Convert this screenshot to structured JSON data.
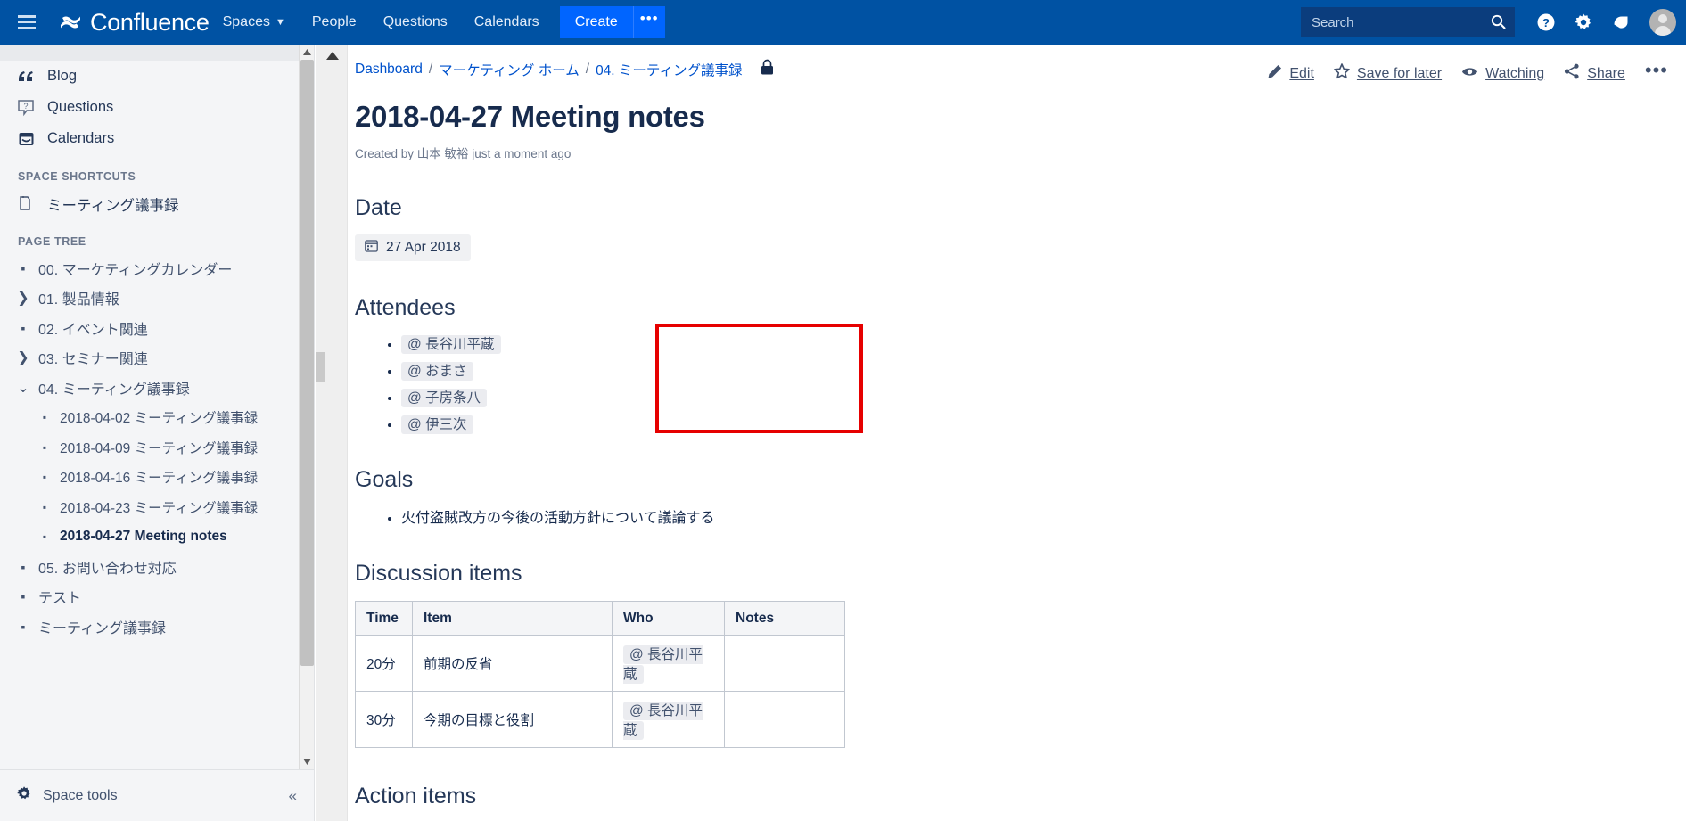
{
  "topnav": {
    "menu_icon": "hamburger-icon",
    "brand": "Confluence",
    "items": [
      {
        "label": "Spaces",
        "has_chevron": true
      },
      {
        "label": "People",
        "has_chevron": false
      },
      {
        "label": "Questions",
        "has_chevron": false
      },
      {
        "label": "Calendars",
        "has_chevron": false
      }
    ],
    "create_label": "Create",
    "create_more_label": "•••",
    "search_placeholder": "Search",
    "search_value": "",
    "icons": [
      "help-icon",
      "gear-icon",
      "notifications-icon",
      "avatar"
    ],
    "bg_color": "#0052a3",
    "create_color": "#0065ff"
  },
  "sidebar": {
    "links": [
      {
        "label": "Blog",
        "icon": "blog-quote-icon"
      },
      {
        "label": "Questions",
        "icon": "question-mark-icon"
      },
      {
        "label": "Calendars",
        "icon": "calendar-icon"
      }
    ],
    "shortcuts_heading": "SPACE SHORTCUTS",
    "shortcuts": [
      {
        "label": "ミーティング議事録",
        "icon": "pages-icon"
      }
    ],
    "pagetree_heading": "PAGE TREE",
    "tree": [
      {
        "label": "00. マーケティングカレンダー",
        "level": 0,
        "marker": "dot",
        "active": false
      },
      {
        "label": "01. 製品情報",
        "level": 0,
        "marker": "chevron-right",
        "active": false
      },
      {
        "label": "02. イベント関連",
        "level": 0,
        "marker": "dot",
        "active": false
      },
      {
        "label": "03. セミナー関連",
        "level": 0,
        "marker": "chevron-right",
        "active": false
      },
      {
        "label": "04. ミーティング議事録",
        "level": 0,
        "marker": "chevron-down",
        "active": false
      },
      {
        "label": "2018-04-02 ミーティング議事録",
        "level": 1,
        "marker": "dot",
        "active": false
      },
      {
        "label": "2018-04-09 ミーティング議事録",
        "level": 1,
        "marker": "dot",
        "active": false
      },
      {
        "label": "2018-04-16 ミーティング議事録",
        "level": 1,
        "marker": "dot",
        "active": false
      },
      {
        "label": "2018-04-23 ミーティング議事録",
        "level": 1,
        "marker": "dot",
        "active": false
      },
      {
        "label": "2018-04-27 Meeting notes",
        "level": 1,
        "marker": "dot",
        "active": true
      },
      {
        "label": "05. お問い合わせ対応",
        "level": 0,
        "marker": "dot",
        "active": false
      },
      {
        "label": "テスト",
        "level": 0,
        "marker": "dot",
        "active": false
      },
      {
        "label": "ミーティング議事録",
        "level": 0,
        "marker": "dot",
        "active": false
      }
    ],
    "space_tools_label": "Space tools",
    "collapse_label": "«"
  },
  "page": {
    "breadcrumb": [
      {
        "label": "Dashboard"
      },
      {
        "label": "マーケティング ホーム"
      },
      {
        "label": "04. ミーティング議事録"
      }
    ],
    "breadcrumb_separator": "/",
    "restriction_icon": "lock-icon",
    "actions": [
      {
        "label": "Edit",
        "icon": "pencil-icon"
      },
      {
        "label": "Save for later",
        "icon": "star-icon"
      },
      {
        "label": "Watching",
        "icon": "eye-icon"
      },
      {
        "label": "Share",
        "icon": "share-icon"
      }
    ],
    "more_actions_label": "•••",
    "title": "2018-04-27 Meeting notes",
    "byline": "Created by 山本 敏裕 just a moment ago",
    "sections": {
      "date_heading": "Date",
      "date_value": "27 Apr 2018",
      "date_icon": "calendar-icon",
      "attendees_heading": "Attendees",
      "attendees": [
        "@ 長谷川平蔵",
        "@ おまさ",
        "@ 子房条八",
        "@ 伊三次"
      ],
      "goals_heading": "Goals",
      "goals": [
        "火付盗賊改方の今後の活動方針について議論する"
      ],
      "discussion_heading": "Discussion items",
      "action_items_heading": "Action items"
    },
    "table": {
      "columns": [
        "Time",
        "Item",
        "Who",
        "Notes"
      ],
      "rows": [
        [
          "20分",
          "前期の反省",
          "@ 長谷川平蔵",
          ""
        ],
        [
          "30分",
          "今期の目標と役割",
          "@ 長谷川平蔵",
          ""
        ]
      ]
    },
    "highlight_color": "#e60000"
  }
}
